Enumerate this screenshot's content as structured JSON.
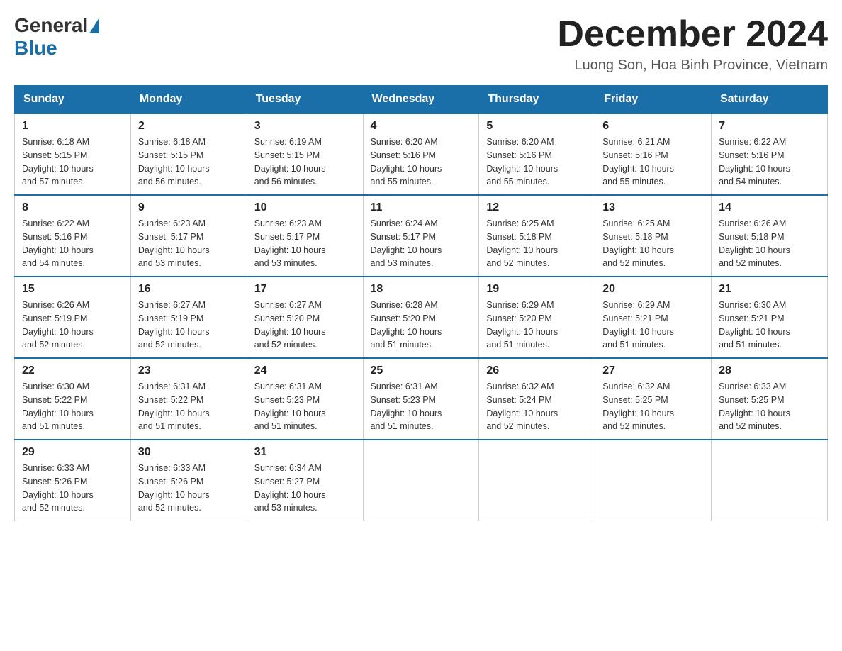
{
  "logo": {
    "general": "General",
    "blue": "Blue"
  },
  "title": "December 2024",
  "location": "Luong Son, Hoa Binh Province, Vietnam",
  "days_of_week": [
    "Sunday",
    "Monday",
    "Tuesday",
    "Wednesday",
    "Thursday",
    "Friday",
    "Saturday"
  ],
  "weeks": [
    [
      {
        "day": "1",
        "sunrise": "6:18 AM",
        "sunset": "5:15 PM",
        "daylight": "10 hours and 57 minutes."
      },
      {
        "day": "2",
        "sunrise": "6:18 AM",
        "sunset": "5:15 PM",
        "daylight": "10 hours and 56 minutes."
      },
      {
        "day": "3",
        "sunrise": "6:19 AM",
        "sunset": "5:15 PM",
        "daylight": "10 hours and 56 minutes."
      },
      {
        "day": "4",
        "sunrise": "6:20 AM",
        "sunset": "5:16 PM",
        "daylight": "10 hours and 55 minutes."
      },
      {
        "day": "5",
        "sunrise": "6:20 AM",
        "sunset": "5:16 PM",
        "daylight": "10 hours and 55 minutes."
      },
      {
        "day": "6",
        "sunrise": "6:21 AM",
        "sunset": "5:16 PM",
        "daylight": "10 hours and 55 minutes."
      },
      {
        "day": "7",
        "sunrise": "6:22 AM",
        "sunset": "5:16 PM",
        "daylight": "10 hours and 54 minutes."
      }
    ],
    [
      {
        "day": "8",
        "sunrise": "6:22 AM",
        "sunset": "5:16 PM",
        "daylight": "10 hours and 54 minutes."
      },
      {
        "day": "9",
        "sunrise": "6:23 AM",
        "sunset": "5:17 PM",
        "daylight": "10 hours and 53 minutes."
      },
      {
        "day": "10",
        "sunrise": "6:23 AM",
        "sunset": "5:17 PM",
        "daylight": "10 hours and 53 minutes."
      },
      {
        "day": "11",
        "sunrise": "6:24 AM",
        "sunset": "5:17 PM",
        "daylight": "10 hours and 53 minutes."
      },
      {
        "day": "12",
        "sunrise": "6:25 AM",
        "sunset": "5:18 PM",
        "daylight": "10 hours and 52 minutes."
      },
      {
        "day": "13",
        "sunrise": "6:25 AM",
        "sunset": "5:18 PM",
        "daylight": "10 hours and 52 minutes."
      },
      {
        "day": "14",
        "sunrise": "6:26 AM",
        "sunset": "5:18 PM",
        "daylight": "10 hours and 52 minutes."
      }
    ],
    [
      {
        "day": "15",
        "sunrise": "6:26 AM",
        "sunset": "5:19 PM",
        "daylight": "10 hours and 52 minutes."
      },
      {
        "day": "16",
        "sunrise": "6:27 AM",
        "sunset": "5:19 PM",
        "daylight": "10 hours and 52 minutes."
      },
      {
        "day": "17",
        "sunrise": "6:27 AM",
        "sunset": "5:20 PM",
        "daylight": "10 hours and 52 minutes."
      },
      {
        "day": "18",
        "sunrise": "6:28 AM",
        "sunset": "5:20 PM",
        "daylight": "10 hours and 51 minutes."
      },
      {
        "day": "19",
        "sunrise": "6:29 AM",
        "sunset": "5:20 PM",
        "daylight": "10 hours and 51 minutes."
      },
      {
        "day": "20",
        "sunrise": "6:29 AM",
        "sunset": "5:21 PM",
        "daylight": "10 hours and 51 minutes."
      },
      {
        "day": "21",
        "sunrise": "6:30 AM",
        "sunset": "5:21 PM",
        "daylight": "10 hours and 51 minutes."
      }
    ],
    [
      {
        "day": "22",
        "sunrise": "6:30 AM",
        "sunset": "5:22 PM",
        "daylight": "10 hours and 51 minutes."
      },
      {
        "day": "23",
        "sunrise": "6:31 AM",
        "sunset": "5:22 PM",
        "daylight": "10 hours and 51 minutes."
      },
      {
        "day": "24",
        "sunrise": "6:31 AM",
        "sunset": "5:23 PM",
        "daylight": "10 hours and 51 minutes."
      },
      {
        "day": "25",
        "sunrise": "6:31 AM",
        "sunset": "5:23 PM",
        "daylight": "10 hours and 51 minutes."
      },
      {
        "day": "26",
        "sunrise": "6:32 AM",
        "sunset": "5:24 PM",
        "daylight": "10 hours and 52 minutes."
      },
      {
        "day": "27",
        "sunrise": "6:32 AM",
        "sunset": "5:25 PM",
        "daylight": "10 hours and 52 minutes."
      },
      {
        "day": "28",
        "sunrise": "6:33 AM",
        "sunset": "5:25 PM",
        "daylight": "10 hours and 52 minutes."
      }
    ],
    [
      {
        "day": "29",
        "sunrise": "6:33 AM",
        "sunset": "5:26 PM",
        "daylight": "10 hours and 52 minutes."
      },
      {
        "day": "30",
        "sunrise": "6:33 AM",
        "sunset": "5:26 PM",
        "daylight": "10 hours and 52 minutes."
      },
      {
        "day": "31",
        "sunrise": "6:34 AM",
        "sunset": "5:27 PM",
        "daylight": "10 hours and 53 minutes."
      },
      null,
      null,
      null,
      null
    ]
  ],
  "labels": {
    "sunrise": "Sunrise:",
    "sunset": "Sunset:",
    "daylight": "Daylight:"
  }
}
